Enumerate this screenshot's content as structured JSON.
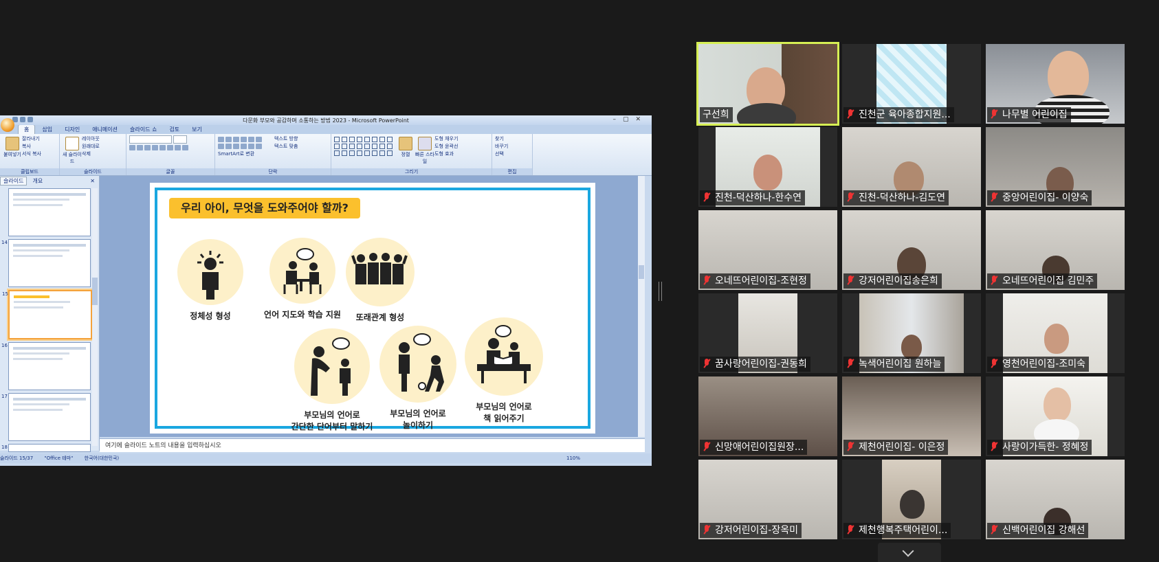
{
  "ppt": {
    "window_title": "다문화 부모와 공감하며 소통하는 방법 2023 - Microsoft PowerPoint",
    "tabs": [
      "홈",
      "삽입",
      "디자인",
      "애니메이션",
      "슬라이드 쇼",
      "검토",
      "보기"
    ],
    "ribbon": {
      "clipboard": {
        "paste": "붙여넣기",
        "cut": "잘라내기",
        "copy": "복사",
        "format_painter": "서식 복사",
        "label": "클립보드"
      },
      "slides": {
        "new_slide": "새 슬라이드",
        "layout": "레이아웃",
        "reset": "원래대로",
        "delete": "삭제",
        "label": "슬라이드"
      },
      "font": {
        "label": "글꼴"
      },
      "paragraph": {
        "text_direction": "텍스트 방향",
        "align_text": "텍스트 맞춤",
        "smartart": "SmartArt로 변환",
        "label": "단락"
      },
      "drawing": {
        "arrange": "정렬",
        "quick_styles": "빠른 스타일",
        "fill": "도형 채우기",
        "outline": "도형 윤곽선",
        "effects": "도형 효과",
        "label": "그리기"
      },
      "editing": {
        "find": "찾기",
        "replace": "바꾸기",
        "select": "선택",
        "label": "편집"
      }
    },
    "left_tabs": [
      "슬라이드",
      "개요"
    ],
    "thumb_numbers": [
      "",
      "14",
      "15",
      "16",
      "17",
      "18"
    ],
    "slide": {
      "heading": "우리 아이, 무엇을 도와주어야 할까?",
      "items": [
        {
          "label": "정체성 형성"
        },
        {
          "label": "언어 지도와 학습 지원"
        },
        {
          "label": "또래관계 형성"
        },
        {
          "label_line1": "부모님의 언어로",
          "label_line2": "간단한 단어부터 말하기"
        },
        {
          "label_line1": "부모님의 언어로",
          "label_line2": "놀이하기"
        },
        {
          "label_line1": "부모님의 언어로",
          "label_line2": "책 읽어주기"
        }
      ]
    },
    "notes_placeholder": "여기에 슬라이드 노트의 내용을 입력하십시오",
    "status": {
      "slide_count": "슬라이드 15/37",
      "theme": "\"Office 테마\"",
      "language": "한국어(대한민국)",
      "zoom": "110%"
    }
  },
  "participants": [
    {
      "name": "구선희",
      "muted": false,
      "active": true
    },
    {
      "name": "진천군 육아종합지원...",
      "muted": true,
      "active": false
    },
    {
      "name": "나무별 어린이집",
      "muted": true,
      "active": false
    },
    {
      "name": "진천-덕산하나-한수연",
      "muted": true,
      "active": false
    },
    {
      "name": "진천-덕산하나-김도연",
      "muted": true,
      "active": false
    },
    {
      "name": "중앙어린이집- 이양숙",
      "muted": true,
      "active": false
    },
    {
      "name": "오네뜨어린이집-조현정",
      "muted": true,
      "active": false
    },
    {
      "name": "강저어린이집송은희",
      "muted": true,
      "active": false
    },
    {
      "name": "오네뜨어린이집 김민주",
      "muted": true,
      "active": false
    },
    {
      "name": "꿈사랑어린이집-권동희",
      "muted": true,
      "active": false
    },
    {
      "name": "녹색어린이집 원하늘",
      "muted": true,
      "active": false
    },
    {
      "name": "영천어린이집-조미숙",
      "muted": true,
      "active": false
    },
    {
      "name": "신망애어린이집원장...",
      "muted": true,
      "active": false
    },
    {
      "name": "제천어린이집- 이은정",
      "muted": true,
      "active": false
    },
    {
      "name": "사랑이가득한- 정혜정",
      "muted": true,
      "active": false
    },
    {
      "name": "강저어린이집-장옥미",
      "muted": true,
      "active": false
    },
    {
      "name": "제천행복주택어린이...",
      "muted": true,
      "active": false
    },
    {
      "name": "신백어린이집 강해선",
      "muted": true,
      "active": false
    }
  ],
  "colors": {
    "active_speaker": "#d6ef54",
    "muted": "#e33333",
    "slide_frame": "#1aa7e0",
    "heading_bg": "#fbc02d"
  }
}
